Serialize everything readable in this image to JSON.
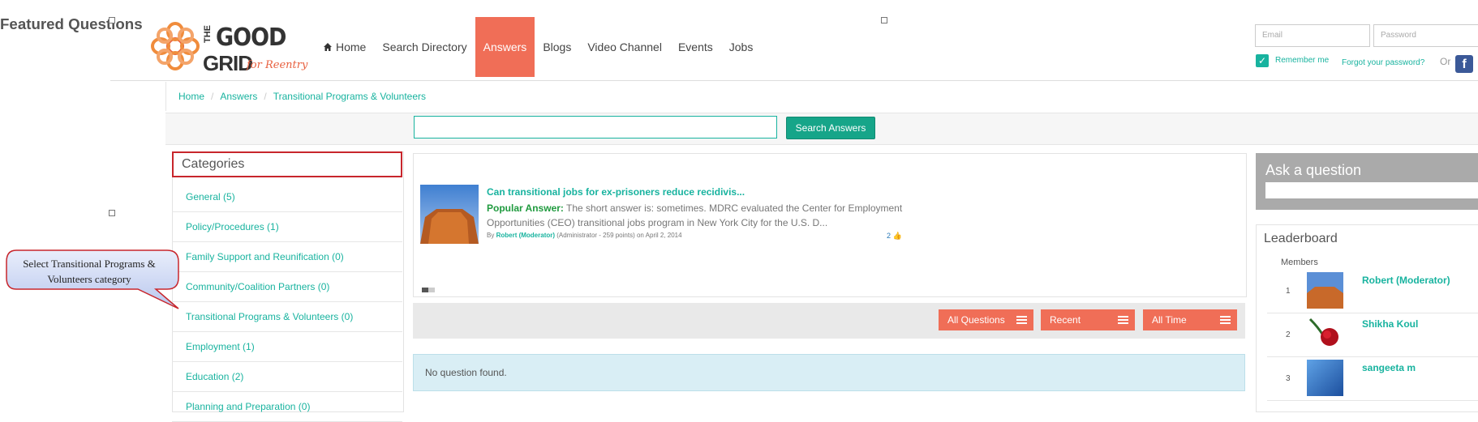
{
  "logo": {
    "word_the": "THE",
    "word_good": "GOOD",
    "word_grid": "GRID",
    "tagline": "for Reentry"
  },
  "nav": {
    "items": [
      {
        "label": "Home",
        "icon": "home-icon"
      },
      {
        "label": "Search Directory"
      },
      {
        "label": "Answers",
        "active": true
      },
      {
        "label": "Blogs"
      },
      {
        "label": "Video Channel"
      },
      {
        "label": "Events"
      },
      {
        "label": "Jobs"
      }
    ]
  },
  "login": {
    "email_placeholder": "Email",
    "password_placeholder": "Password",
    "remember_label": "Remember me",
    "forgot_label": "Forgot your password?",
    "or_label": "Or",
    "facebook_icon": "f"
  },
  "breadcrumb": {
    "items": [
      "Home",
      "Answers",
      "Transitional Programs & Volunteers"
    ]
  },
  "search": {
    "button_label": "Search Answers",
    "value": ""
  },
  "categories": {
    "title": "Categories",
    "items": [
      "General (5)",
      "Policy/Procedures (1)",
      "Family Support and Reunification (0)",
      "Community/Coalition Partners (0)",
      "Transitional Programs & Volunteers (0)",
      "Employment (1)",
      "Education (2)",
      "Planning and Preparation (0)"
    ]
  },
  "callout": {
    "text": "Select Transitional Programs & Volunteers category"
  },
  "featured": {
    "title": "Featured Questions",
    "question": {
      "title": "Can transitional jobs for ex-prisoners reduce recidivis...",
      "answer_label": "Popular Answer:",
      "answer_text": "The short answer is: sometimes. MDRC evaluated the Center for Employment Opportunities (CEO) transitional jobs program in New York City for the U.S. D...",
      "by": "By",
      "user": "Robert (Moderator)",
      "user_meta": "(Administrator - 259 points)",
      "date": "on April 2, 2014",
      "votes": "2"
    }
  },
  "filters": [
    {
      "label": "All Questions"
    },
    {
      "label": "Recent"
    },
    {
      "label": "All Time"
    }
  ],
  "empty_message": "No question found.",
  "ask": {
    "title": "Ask a question"
  },
  "leaderboard": {
    "title": "Leaderboard",
    "members_label": "Members",
    "rows": [
      {
        "rank": "1",
        "name": "Robert (Moderator)"
      },
      {
        "rank": "2",
        "name": "Shikha Koul"
      },
      {
        "rank": "3",
        "name": "sangeeta m"
      }
    ]
  },
  "colors": {
    "accent": "#f06e57",
    "teal": "#18b39f",
    "button": "#16a589",
    "callout_border": "#c8262c"
  }
}
